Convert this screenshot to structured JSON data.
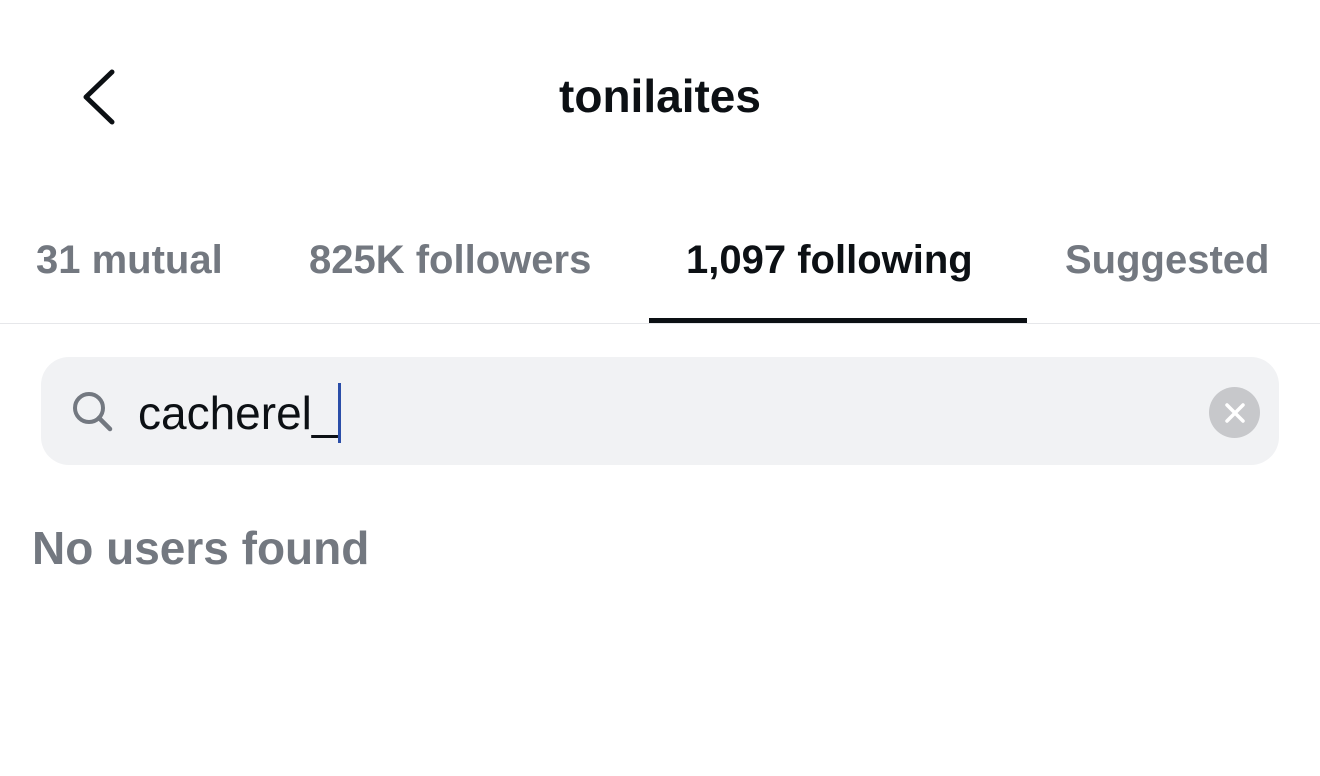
{
  "header": {
    "title": "tonilaites",
    "back_icon": "chevron-left-icon"
  },
  "tabs": [
    {
      "label": "31 mutual",
      "active": false
    },
    {
      "label": "825K followers",
      "active": false
    },
    {
      "label": "1,097 following",
      "active": true
    },
    {
      "label": "Suggested",
      "active": false
    }
  ],
  "search": {
    "value": "cacherel_",
    "icon": "search-icon",
    "clear_icon": "close-icon"
  },
  "results": {
    "empty_message": "No users found"
  },
  "colors": {
    "text_primary": "#0c1014",
    "text_secondary": "#737880",
    "search_bg": "#f1f2f4",
    "caret": "#2b4ea8"
  }
}
